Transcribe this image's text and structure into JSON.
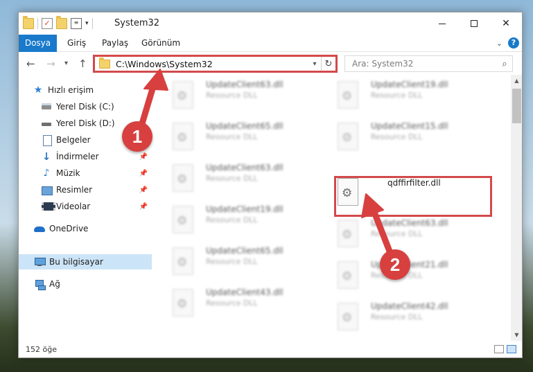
{
  "window": {
    "title": "System32",
    "minimize_label": "",
    "maximize_label": "",
    "close_label": "✕"
  },
  "ribbon": {
    "tabs": [
      {
        "label": "Dosya",
        "active": true
      },
      {
        "label": "Giriş"
      },
      {
        "label": "Paylaş"
      },
      {
        "label": "Görünüm"
      }
    ],
    "help": "?"
  },
  "address": {
    "path": "C:\\Windows\\System32",
    "search_placeholder": "Ara: System32"
  },
  "nav": {
    "items": [
      {
        "label": "Hızlı erişim",
        "icon": "star-icon"
      },
      {
        "label": "Yerel Disk (C:)",
        "icon": "drive-icon",
        "pinned": true
      },
      {
        "label": "Yerel Disk (D:)",
        "icon": "drive-icon",
        "pinned": true
      },
      {
        "label": "Belgeler",
        "icon": "documents-icon",
        "pinned": true
      },
      {
        "label": "İndirmeler",
        "icon": "downloads-icon",
        "pinned": true
      },
      {
        "label": "Müzik",
        "icon": "music-icon",
        "pinned": true
      },
      {
        "label": "Resimler",
        "icon": "pictures-icon",
        "pinned": true
      },
      {
        "label": "Videolar",
        "icon": "videos-icon",
        "pinned": true
      },
      {
        "label": "OneDrive",
        "icon": "onedrive-icon"
      },
      {
        "label": "Bu bilgisayar",
        "icon": "this-pc-icon",
        "selected": true
      },
      {
        "label": "Ağ",
        "icon": "network-icon"
      }
    ]
  },
  "files": {
    "left": [
      {
        "name": "UpdateClient63.dll",
        "desc": "Resource DLL"
      },
      {
        "name": "UpdateClient65.dll",
        "desc": "Resource DLL"
      },
      {
        "name": "UpdateClient63.dll",
        "desc": "Resource DLL"
      },
      {
        "name": "UpdateClient19.dll",
        "desc": "Resource DLL"
      },
      {
        "name": "UpdateClient65.dll",
        "desc": "Resource DLL"
      },
      {
        "name": "UpdateClient43.dll",
        "desc": "Resource DLL"
      }
    ],
    "right": [
      {
        "name": "UpdateClient19.dll",
        "desc": "Resource DLL"
      },
      {
        "name": "UpdateClient15.dll",
        "desc": "Resource DLL"
      },
      {
        "name": "qdffirfilter.dll",
        "desc": ""
      },
      {
        "name": "UpdateClient63.dll",
        "desc": "Resource DLL"
      },
      {
        "name": "UpdateClient21.dll",
        "desc": "Resource DLL"
      },
      {
        "name": "UpdateClient42.dll",
        "desc": "Resource DLL"
      }
    ]
  },
  "status": {
    "count": "152 öğe"
  },
  "annotations": {
    "step1": "1",
    "step2": "2",
    "color": "#d7403f"
  }
}
